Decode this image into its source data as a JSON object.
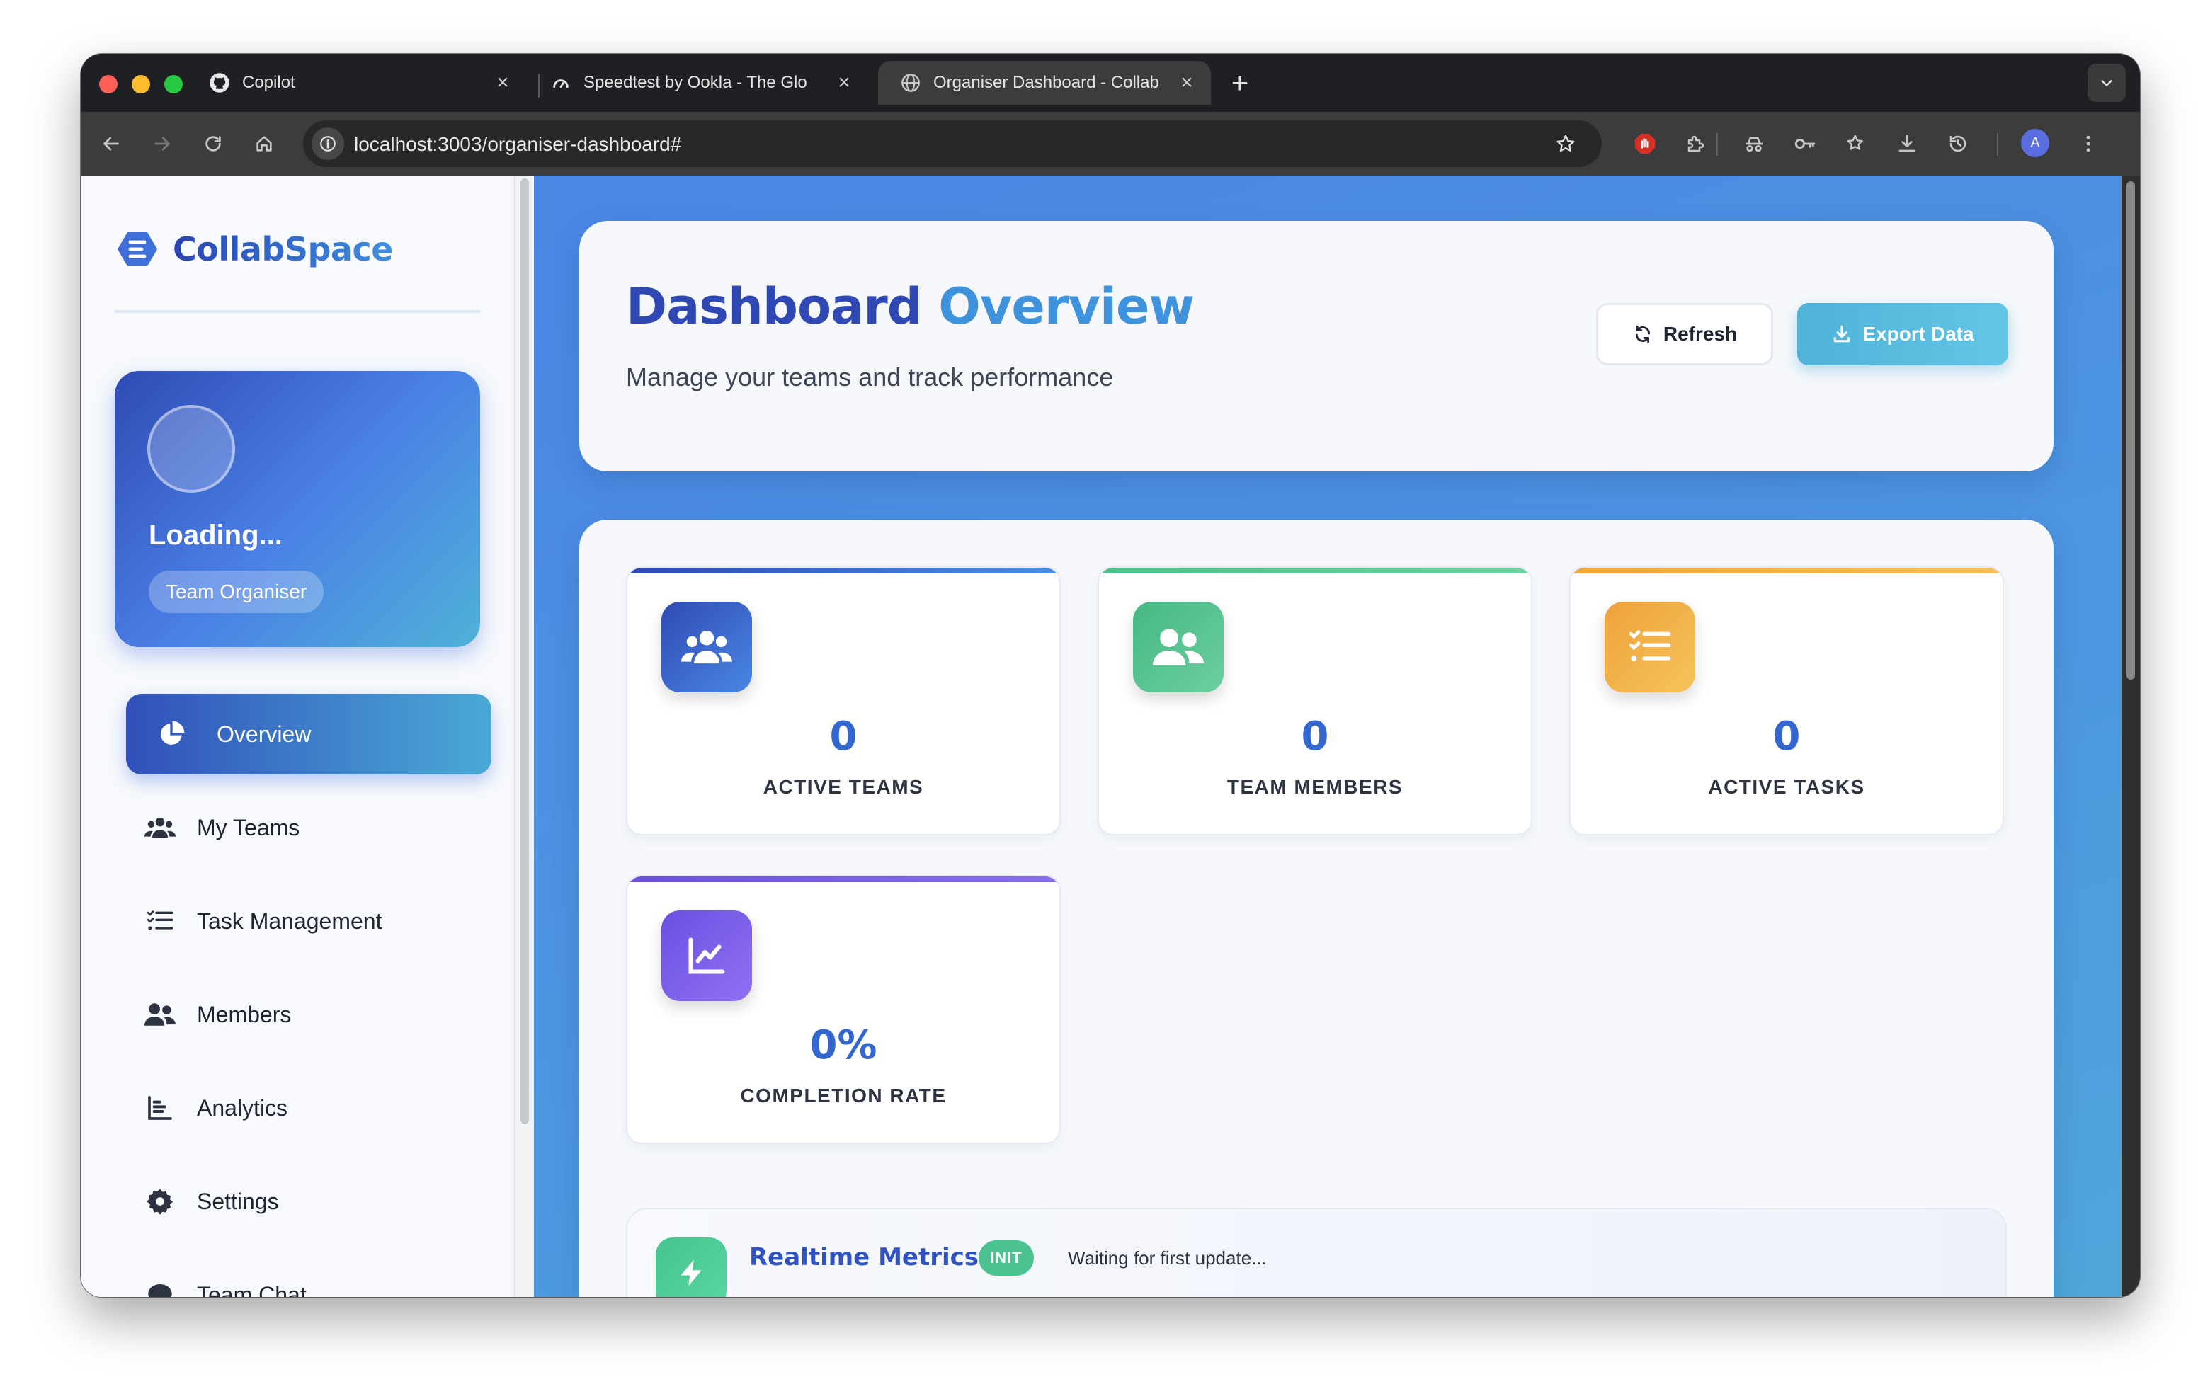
{
  "browser": {
    "tabs": [
      {
        "title": "Copilot",
        "icon": "github-icon"
      },
      {
        "title": "Speedtest by Ookla - The Glo",
        "icon": "speedtest-icon"
      },
      {
        "title": "Organiser Dashboard - Collab",
        "icon": "globe-icon",
        "active": true
      }
    ],
    "url": "localhost:3003/organiser-dashboard#",
    "profile_initial": "A"
  },
  "sidebar": {
    "brand": "CollabSpace",
    "profile": {
      "name": "Loading...",
      "role": "Team Organiser"
    },
    "nav": [
      {
        "label": "Overview",
        "icon": "pie-chart-icon",
        "active": true
      },
      {
        "label": "My Teams",
        "icon": "users-icon"
      },
      {
        "label": "Task Management",
        "icon": "task-list-icon"
      },
      {
        "label": "Members",
        "icon": "user-group-icon"
      },
      {
        "label": "Analytics",
        "icon": "bar-chart-icon"
      },
      {
        "label": "Settings",
        "icon": "gear-icon"
      },
      {
        "label": "Team Chat",
        "icon": "chat-icon"
      }
    ]
  },
  "header": {
    "title_part1": "Dashboard",
    "title_part2": "Overview",
    "subtitle": "Manage your teams and track performance",
    "refresh_label": "Refresh",
    "export_label": "Export Data"
  },
  "stats": [
    {
      "value": "0",
      "label": "ACTIVE TEAMS",
      "icon": "users-icon",
      "color": "#3a5cc8"
    },
    {
      "value": "0",
      "label": "TEAM MEMBERS",
      "icon": "user-group-icon",
      "color": "#4cbf8a"
    },
    {
      "value": "0",
      "label": "ACTIVE TASKS",
      "icon": "task-list-icon",
      "color": "#f0ad3c"
    },
    {
      "value": "0%",
      "label": "COMPLETION RATE",
      "icon": "line-chart-icon",
      "color": "#7a5ce6"
    }
  ],
  "realtime": {
    "title": "Realtime Metrics",
    "badge": "INIT",
    "status": "Waiting for first update..."
  }
}
